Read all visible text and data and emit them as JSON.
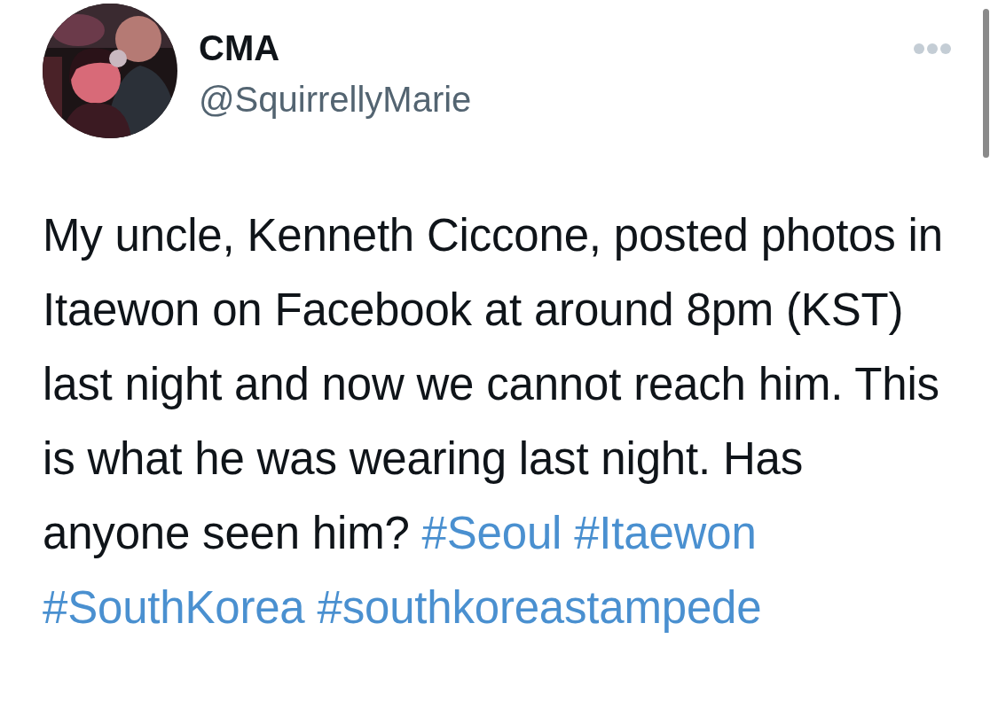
{
  "author": {
    "name": "CMA",
    "handle": "@SquirrellyMarie"
  },
  "tweet": {
    "text": "My uncle, Kenneth Ciccone, posted photos in Itaewon on Facebook at around 8pm (KST) last night and now we cannot reach him. This is what he was wearing last night. Has anyone seen him?",
    "hashtags": [
      "#Seoul",
      "#Itaewon",
      "#SouthKorea",
      "#southkoreastampede"
    ]
  }
}
